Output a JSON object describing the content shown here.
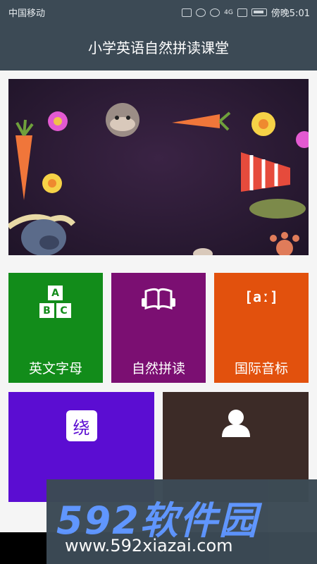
{
  "statusbar": {
    "carrier": "中国移动",
    "time": "傍晚5:01",
    "network": "4G"
  },
  "header": {
    "title": "小学英语自然拼读课堂"
  },
  "banner": {
    "description": ""
  },
  "tiles": [
    {
      "label": "英文字母",
      "icon": "abc-blocks-icon",
      "color": "#128c1a",
      "glyph": [
        "A",
        "B",
        "C"
      ]
    },
    {
      "label": "自然拼读",
      "icon": "open-book-headphones-icon",
      "color": "#7b0f72"
    },
    {
      "label": "国际音标",
      "icon": "phonetic-symbol-icon",
      "color": "#e2510d",
      "glyph": "[aː]"
    },
    {
      "label": "",
      "icon": "tongue-twister-icon",
      "color": "#5b0dd2",
      "glyph": "绕"
    },
    {
      "label": "",
      "icon": "user-icon",
      "color": "#3c2b27"
    }
  ],
  "watermark": {
    "brand": "592软件园",
    "url": "www.592xiazai.com"
  }
}
